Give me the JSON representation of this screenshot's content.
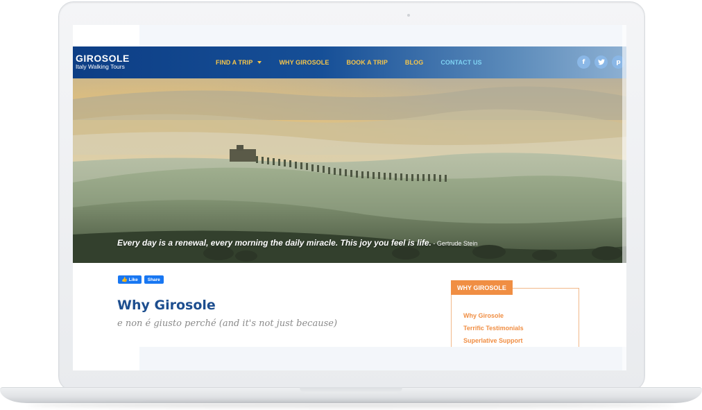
{
  "site": {
    "brand_name": "GIROSOLE",
    "brand_tagline": "Italy Walking Tours"
  },
  "nav": {
    "items": [
      {
        "label": "FIND A TRIP",
        "has_dropdown": true,
        "active": false
      },
      {
        "label": "WHY GIROSOLE",
        "active": false
      },
      {
        "label": "BOOK A TRIP",
        "active": false
      },
      {
        "label": "BLOG",
        "active": false
      },
      {
        "label": "CONTACT US",
        "active": true
      }
    ]
  },
  "social": {
    "icons": [
      "facebook-icon",
      "twitter-icon",
      "pinterest-icon"
    ],
    "glyphs": [
      "f",
      "t",
      "p"
    ]
  },
  "hero": {
    "quote": "Every day is a renewal, every morning the daily miracle. This joy you feel is life.",
    "author": " - Gertrude Stein"
  },
  "facebook": {
    "like_label": "Like",
    "share_label": "Share"
  },
  "content": {
    "title": "Why Girosole",
    "subtitle": "e non é giusto perché (and it's not just because)"
  },
  "sidebar": {
    "title": "WHY GIROSOLE",
    "links": [
      "Why Girosole",
      "Terrific Testimonials",
      "Superlative Support"
    ]
  },
  "colors": {
    "header_blue": "#0d3e85",
    "nav_yellow": "#f7c64a",
    "nav_active": "#7fd3f3",
    "title_blue": "#1d4e8f",
    "accent_orange": "#f08e43",
    "facebook_blue": "#1877f2"
  }
}
